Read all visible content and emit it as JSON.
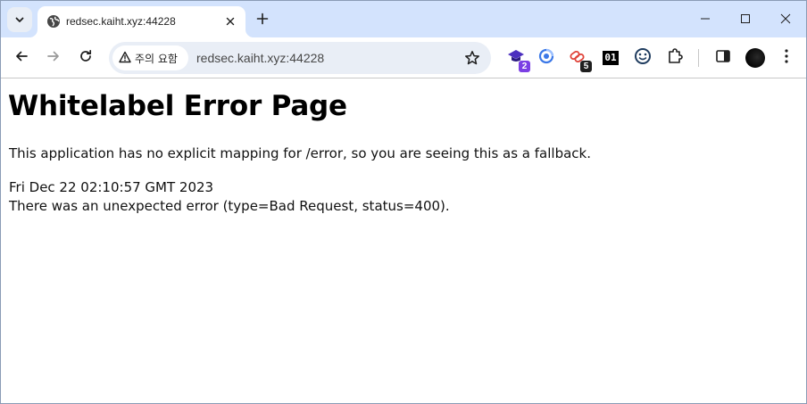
{
  "browser": {
    "tab": {
      "title": "redsec.kaiht.xyz:44228"
    },
    "new_tab_glyph": "+",
    "address_bar": {
      "security_chip_label": "주의 요함",
      "url": "redsec.kaiht.xyz:44228"
    },
    "extensions": [
      {
        "icon": "graduation-cap-icon",
        "badge": "2",
        "badge_color": "#7b3fe4"
      },
      {
        "icon": "target-icon",
        "badge": ""
      },
      {
        "icon": "link-icon",
        "badge": "5",
        "badge_color": "#1f1f1f"
      },
      {
        "icon": "binary-01-icon",
        "label": "01",
        "badge": ""
      },
      {
        "icon": "smiley-icon",
        "badge": ""
      },
      {
        "icon": "puzzle-icon",
        "badge": ""
      }
    ]
  },
  "page": {
    "heading": "Whitelabel Error Page",
    "message": "This application has no explicit mapping for /error, so you are seeing this as a fallback.",
    "timestamp": "Fri Dec 22 02:10:57 GMT 2023",
    "error_detail": "There was an unexpected error (type=Bad Request, status=400)."
  },
  "colors": {
    "tabstrip_bg": "#d3e3fd",
    "omnibox_bg": "#e9eef6",
    "text": "#1f1f1f"
  }
}
